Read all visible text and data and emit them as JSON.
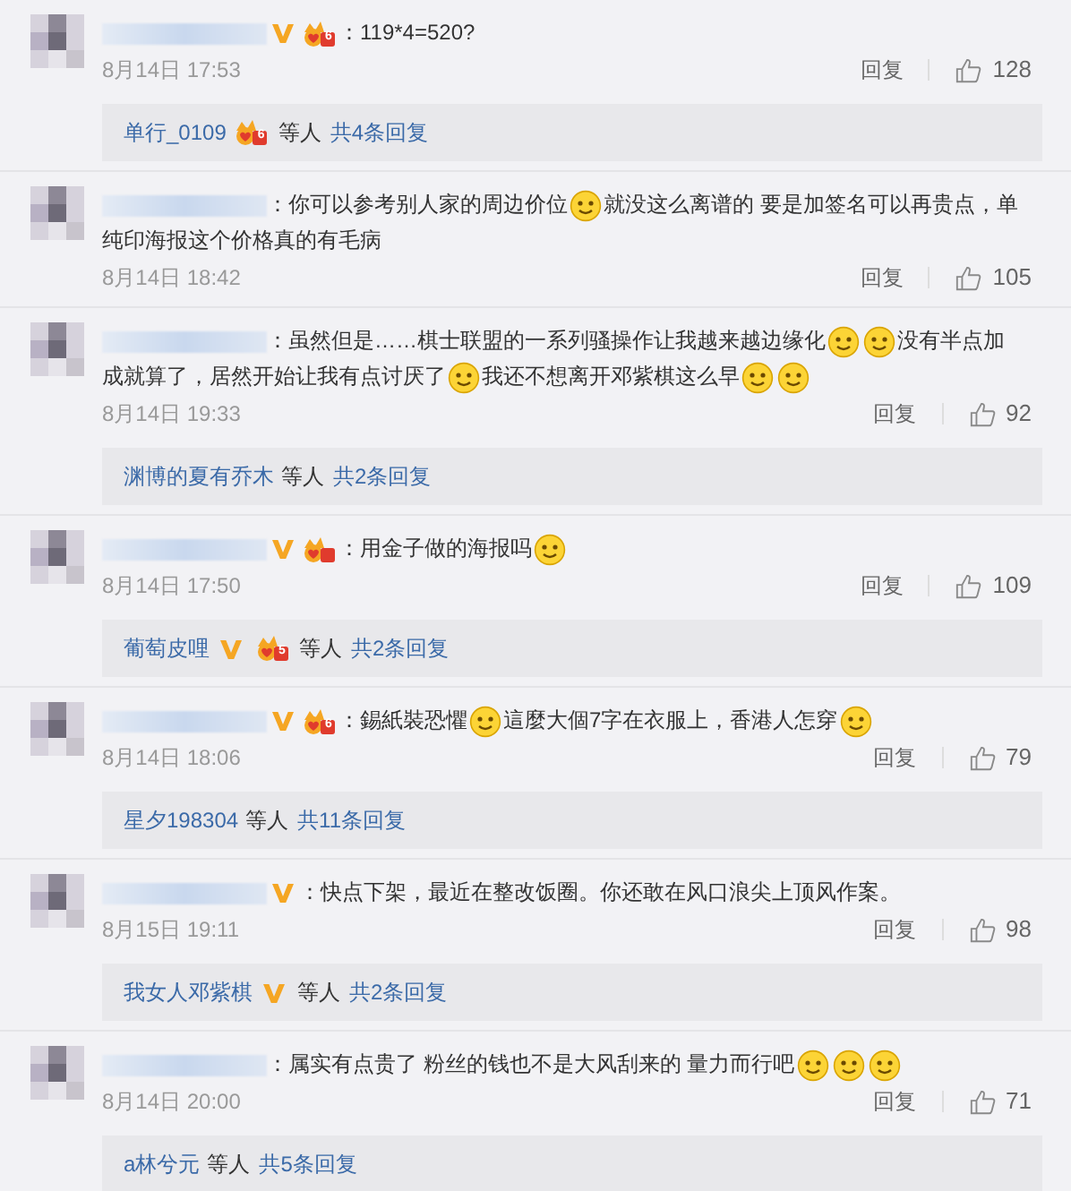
{
  "comments": [
    {
      "verified": true,
      "badges": [
        {
          "kind": "vip",
          "text": "6"
        }
      ],
      "content": [
        {
          "kind": "text",
          "text": "：119*4=520?"
        }
      ],
      "time": "8月14日 17:53",
      "reply_label": "回复",
      "likes": "128",
      "replies": {
        "users": [
          {
            "name": "单行_0109",
            "verified": false,
            "badges": [
              {
                "kind": "vip",
                "text": "6"
              }
            ]
          }
        ],
        "suffix": "等人",
        "count": "共4条回复"
      }
    },
    {
      "verified": false,
      "content": [
        {
          "kind": "text",
          "text": "：你可以参考别人家的周边价位"
        },
        {
          "kind": "emoji"
        },
        {
          "kind": "text",
          "text": "就没这么离谱的 要是加签名可以再贵点，单纯印海报这个价格真的有毛病"
        }
      ],
      "time": "8月14日 18:42",
      "reply_label": "回复",
      "likes": "105"
    },
    {
      "verified": false,
      "content": [
        {
          "kind": "text",
          "text": "：虽然但是……棋士联盟的一系列骚操作让我越来越边缘化"
        },
        {
          "kind": "emoji"
        },
        {
          "kind": "emoji"
        },
        {
          "kind": "text",
          "text": "没有半点加成就算了，居然开始让我有点讨厌了"
        },
        {
          "kind": "emoji"
        },
        {
          "kind": "text",
          "text": "我还不想离开邓紫棋这么早"
        },
        {
          "kind": "emoji"
        },
        {
          "kind": "emoji"
        }
      ],
      "time": "8月14日 19:33",
      "reply_label": "回复",
      "likes": "92",
      "replies": {
        "users": [
          {
            "name": "渊博的夏有乔木",
            "verified": false
          }
        ],
        "suffix": "等人",
        "count": "共2条回复"
      }
    },
    {
      "verified": true,
      "badges": [
        {
          "kind": "vip"
        }
      ],
      "content": [
        {
          "kind": "text",
          "text": "：用金子做的海报吗"
        },
        {
          "kind": "emoji"
        }
      ],
      "time": "8月14日 17:50",
      "reply_label": "回复",
      "likes": "109",
      "replies": {
        "users": [
          {
            "name": "葡萄皮哩",
            "verified": true,
            "badges": [
              {
                "kind": "vip",
                "text": "5"
              }
            ]
          }
        ],
        "suffix": "等人",
        "count": "共2条回复"
      }
    },
    {
      "verified": true,
      "badges": [
        {
          "kind": "vip",
          "text": "6"
        }
      ],
      "content": [
        {
          "kind": "text",
          "text": "：錫紙裝恐懼"
        },
        {
          "kind": "emoji"
        },
        {
          "kind": "text",
          "text": "這麼大個7字在衣服上，香港人怎穿"
        },
        {
          "kind": "emoji"
        }
      ],
      "time": "8月14日 18:06",
      "reply_label": "回复",
      "likes": "79",
      "replies": {
        "users": [
          {
            "name": "星夕198304",
            "verified": false
          }
        ],
        "suffix": "等人",
        "count": "共11条回复"
      }
    },
    {
      "verified": true,
      "content": [
        {
          "kind": "text",
          "text": "：快点下架，最近在整改饭圈。你还敢在风口浪尖上顶风作案。"
        }
      ],
      "time": "8月15日 19:11",
      "reply_label": "回复",
      "likes": "98",
      "replies": {
        "users": [
          {
            "name": "我女人邓紫棋",
            "verified": true
          }
        ],
        "suffix": "等人",
        "count": "共2条回复"
      }
    },
    {
      "verified": false,
      "content": [
        {
          "kind": "text",
          "text": "：属实有点贵了 粉丝的钱也不是大风刮来的 量力而行吧"
        },
        {
          "kind": "emoji"
        },
        {
          "kind": "emoji"
        },
        {
          "kind": "emoji"
        }
      ],
      "time": "8月14日 20:00",
      "reply_label": "回复",
      "likes": "71",
      "replies": {
        "users": [
          {
            "name": "a林兮元",
            "verified": false
          }
        ],
        "suffix": "等人",
        "count": "共5条回复"
      }
    }
  ]
}
